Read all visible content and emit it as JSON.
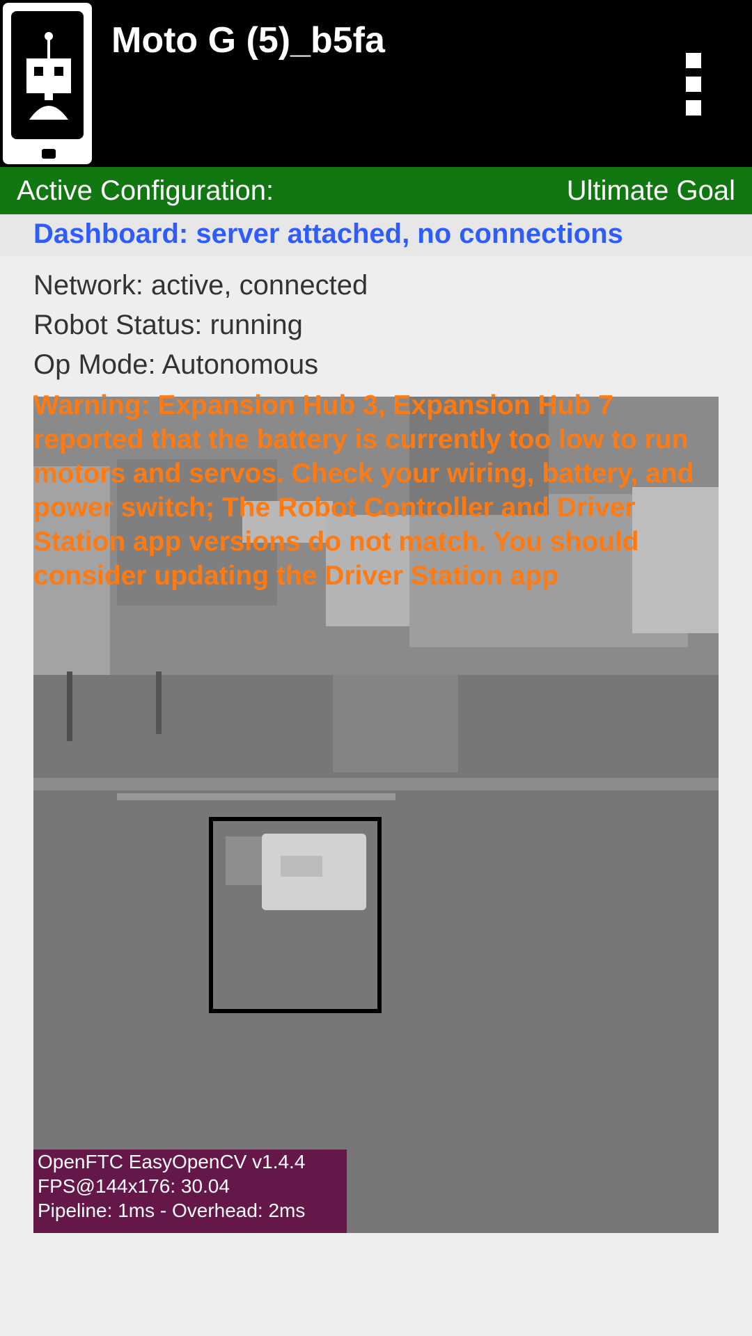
{
  "header": {
    "title": "Moto G (5)_b5fa",
    "app_icon": "robot-controller-icon",
    "menu_icon": "overflow-menu-icon"
  },
  "config": {
    "label": "Active Configuration:",
    "value": "Ultimate Goal"
  },
  "status": {
    "dashboard": "Dashboard: server attached, no connections",
    "network": "Network: active, connected",
    "robot": "Robot Status: running",
    "op_mode": "Op Mode: Autonomous",
    "warning": "Warning: Expansion Hub 3, Expansion Hub 7 reported that the battery is currently too low to run motors and servos. Check your wiring, battery, and power switch; The Robot Controller and Driver Station app versions do not match. You should consider updating the Driver Station app"
  },
  "camera_overlay": {
    "line1": "OpenFTC EasyOpenCV v1.4.4",
    "line2": "FPS@144x176: 30.04",
    "line3": "Pipeline: 1ms - Overhead: 2ms"
  },
  "colors": {
    "app_bar": "#000000",
    "config_bar": "#117711",
    "dashboard_text": "#2f5cff",
    "warning_text": "#ff7a10",
    "overlay_bg": "#66174a"
  }
}
